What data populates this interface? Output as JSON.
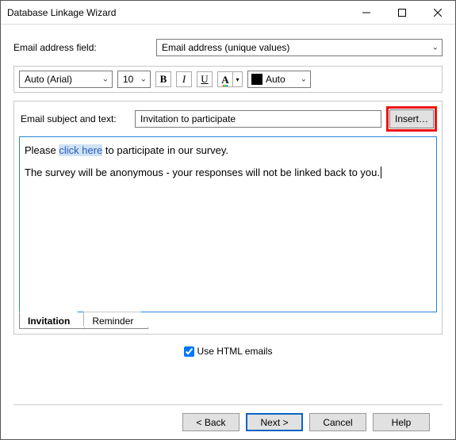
{
  "window": {
    "title": "Database Linkage Wizard"
  },
  "email_field": {
    "label": "Email address field:",
    "value": "Email address (unique values)"
  },
  "toolbar": {
    "font": "Auto (Arial)",
    "size": "10",
    "bold": "B",
    "italic": "I",
    "underline": "U",
    "color_glyph": "A",
    "fill_label": "Auto"
  },
  "subject": {
    "label": "Email subject and text:",
    "value": "Invitation to participate",
    "insert": "Insert…"
  },
  "body": {
    "line1_pre": "Please ",
    "line1_link": "click here",
    "line1_post": " to participate in our survey.",
    "line2": "The survey will be anonymous - your responses will not be linked back to you."
  },
  "tabs": {
    "invitation": "Invitation",
    "reminder": "Reminder"
  },
  "options": {
    "html_emails": "Use HTML emails"
  },
  "buttons": {
    "back": "< Back",
    "next": "Next >",
    "cancel": "Cancel",
    "help": "Help"
  }
}
